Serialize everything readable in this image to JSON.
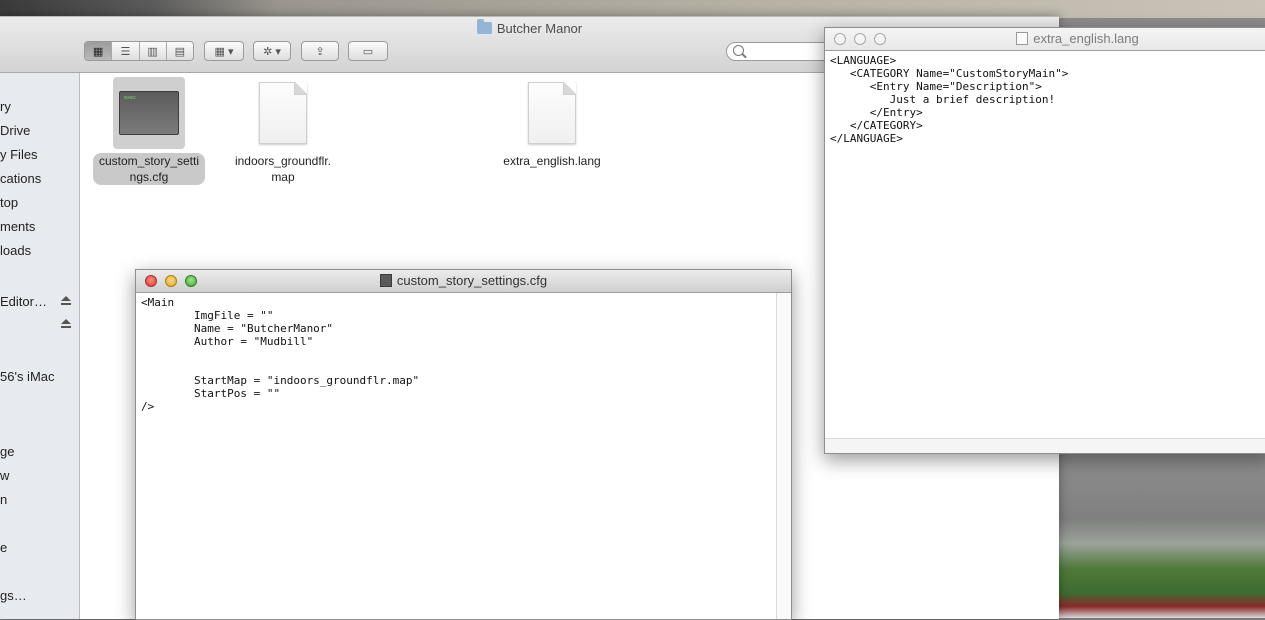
{
  "finder": {
    "title": "Butcher Manor",
    "sidebar": [
      {
        "label": "ry"
      },
      {
        "label": "Drive"
      },
      {
        "label": "y Files"
      },
      {
        "label": "cations"
      },
      {
        "label": "top"
      },
      {
        "label": "ments"
      },
      {
        "label": "loads"
      },
      {
        "label": "Editor…"
      },
      {
        "label": ""
      },
      {
        "label": "56's iMac"
      },
      {
        "label": "ge"
      },
      {
        "label": "w"
      },
      {
        "label": "n"
      },
      {
        "label": "e"
      },
      {
        "label": "gs…"
      }
    ],
    "files": [
      {
        "name_line1": "custom_story_setti",
        "name_line2": "ngs.cfg",
        "kind": "exec-icon",
        "thumb_text": "exec"
      },
      {
        "name_line1": "indoors_groundflr.",
        "name_line2": "map",
        "kind": "document-icon"
      },
      {
        "name_line1": "extra_english.lang",
        "name_line2": "",
        "kind": "document-icon"
      }
    ]
  },
  "editor_cfg": {
    "title": "custom_story_settings.cfg",
    "content": "<Main\n        ImgFile = \"\"\n        Name = \"ButcherManor\"\n        Author = \"Mudbill\"\n\n\n        StartMap = \"indoors_groundflr.map\"\n        StartPos = \"\"\n/>"
  },
  "editor_lang": {
    "title": "extra_english.lang",
    "content": "<LANGUAGE>\n   <CATEGORY Name=\"CustomStoryMain\">\n      <Entry Name=\"Description\">\n         Just a brief description!\n      </Entry>\n   </CATEGORY>\n</LANGUAGE>"
  }
}
